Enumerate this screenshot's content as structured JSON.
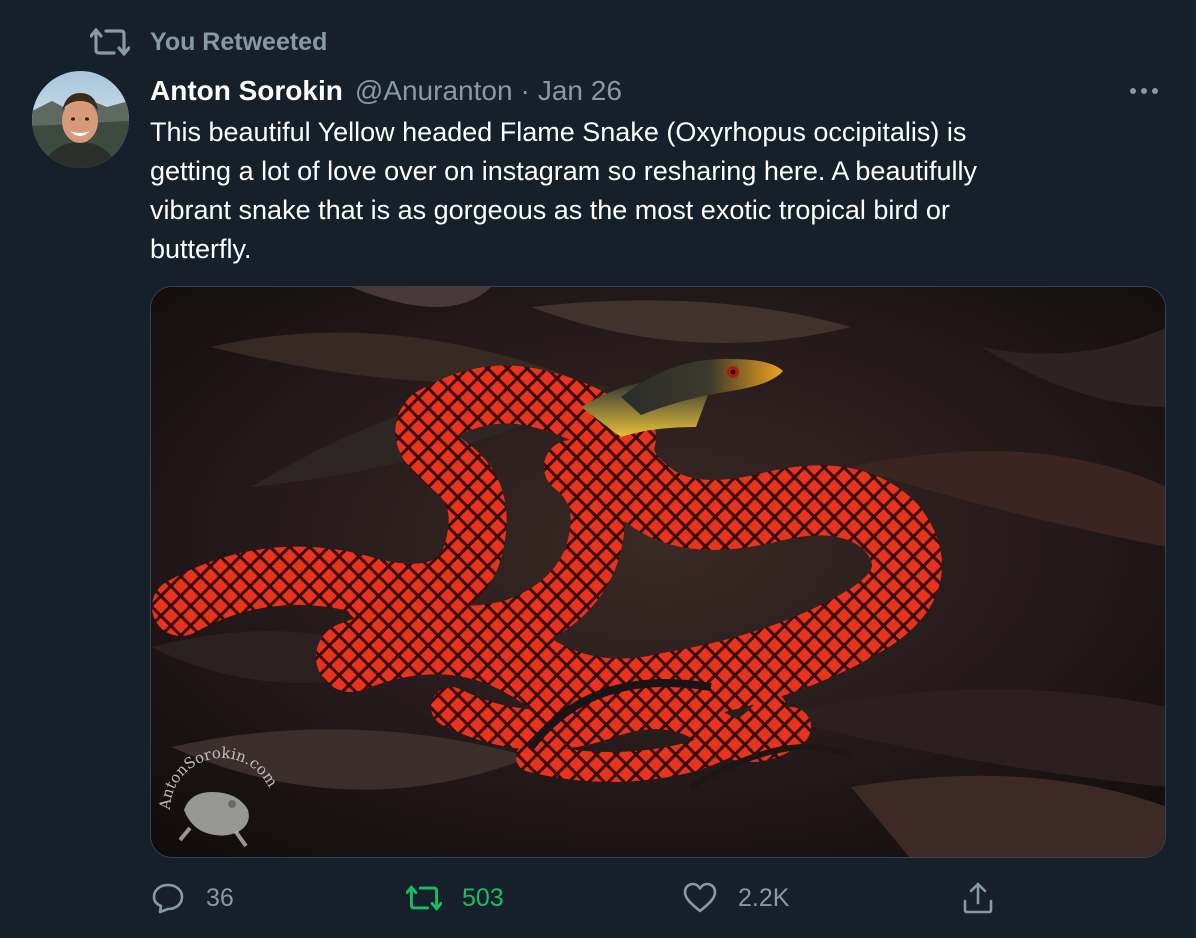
{
  "retweet_banner": {
    "label": "You Retweeted",
    "icon": "retweet-icon"
  },
  "author": {
    "name": "Anton Sorokin",
    "handle": "@Anuranton",
    "separator": "·",
    "date": "Jan 26"
  },
  "tweet": {
    "text_lines": [
      "This beautiful Yellow headed Flame Snake (Oxyrhopus occipitalis) is",
      "getting a lot of love over on instagram so resharing here.  A beautifully",
      "vibrant snake that is as gorgeous as the most exotic tropical bird or",
      "butterfly."
    ]
  },
  "media": {
    "watermark_text": "AntonSorokin.com"
  },
  "actions": {
    "reply": {
      "icon": "reply-icon",
      "count": "36"
    },
    "retweet": {
      "icon": "retweet-icon",
      "count": "503",
      "active": true
    },
    "like": {
      "icon": "heart-icon",
      "count": "2.2K"
    },
    "share": {
      "icon": "share-icon"
    }
  },
  "colors": {
    "background": "#15202b",
    "secondary_text": "#8899a6",
    "retweet_active": "#17bf63",
    "primary_text": "#ffffff"
  }
}
